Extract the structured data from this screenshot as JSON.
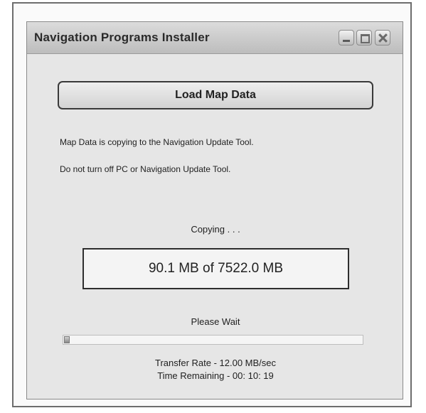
{
  "window": {
    "title": "Navigation Programs Installer",
    "buttons": {
      "minimize": "minimize-icon",
      "maximize": "maximize-icon",
      "close": "close-icon"
    }
  },
  "main": {
    "load_button_label": "Load Map Data",
    "message_line1": "Map Data is copying to the Navigation Update Tool.",
    "message_line2": "Do not turn off PC or Navigation Update Tool.",
    "status_label": "Copying . . .",
    "progress_text": "90.1 MB of 7522.0 MB",
    "wait_label": "Please Wait",
    "progress_fraction": 0.012,
    "transfer_rate": "Transfer Rate - 12.00 MB/sec",
    "time_remaining": "Time Remaining - 00: 10: 19"
  }
}
